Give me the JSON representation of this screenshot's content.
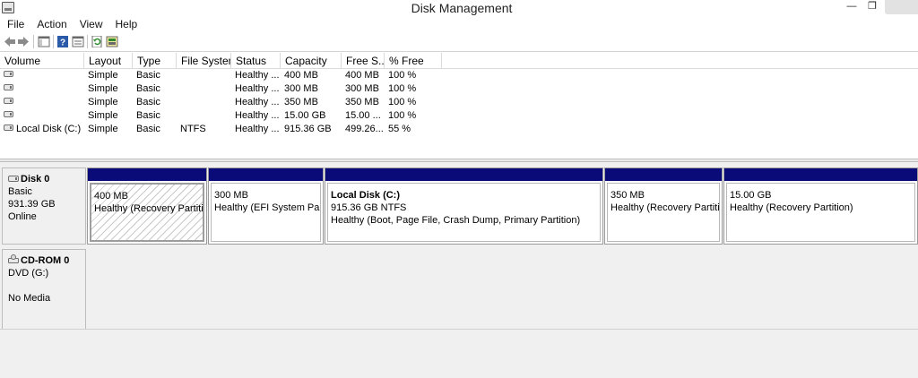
{
  "window": {
    "title": "Disk Management",
    "controls": {
      "minimize": "—",
      "maximize": "❐",
      "close": ""
    }
  },
  "menu": [
    "File",
    "Action",
    "View",
    "Help"
  ],
  "toolbar": {
    "icons": [
      "back-icon",
      "forward-icon",
      "console-tree-icon",
      "help-icon",
      "properties-icon",
      "refresh-icon",
      "rescan-icon"
    ]
  },
  "volume_table": {
    "columns": [
      "Volume",
      "Layout",
      "Type",
      "File System",
      "Status",
      "Capacity",
      "Free S...",
      "% Free"
    ],
    "rows": [
      {
        "volume": "",
        "layout": "Simple",
        "type": "Basic",
        "fs": "",
        "status": "Healthy ...",
        "capacity": "400 MB",
        "free": "400 MB",
        "pct": "100 %"
      },
      {
        "volume": "",
        "layout": "Simple",
        "type": "Basic",
        "fs": "",
        "status": "Healthy ...",
        "capacity": "300 MB",
        "free": "300 MB",
        "pct": "100 %"
      },
      {
        "volume": "",
        "layout": "Simple",
        "type": "Basic",
        "fs": "",
        "status": "Healthy ...",
        "capacity": "350 MB",
        "free": "350 MB",
        "pct": "100 %"
      },
      {
        "volume": "",
        "layout": "Simple",
        "type": "Basic",
        "fs": "",
        "status": "Healthy ...",
        "capacity": "15.00 GB",
        "free": "15.00 ...",
        "pct": "100 %"
      },
      {
        "volume": "Local Disk  (C:)",
        "layout": "Simple",
        "type": "Basic",
        "fs": "NTFS",
        "status": "Healthy ...",
        "capacity": "915.36 GB",
        "free": "499.26...",
        "pct": "55 %"
      }
    ]
  },
  "disks": [
    {
      "name": "Disk 0",
      "type": "Basic",
      "size": "931.39 GB",
      "status": "Online",
      "partitions": [
        {
          "name": "",
          "size": "400 MB",
          "status": "Healthy (Recovery Partition)"
        },
        {
          "name": "",
          "size": "300 MB",
          "status": "Healthy (EFI System Partition)"
        },
        {
          "name": "Local Disk   (C:)",
          "size": "915.36 GB NTFS",
          "status": "Healthy (Boot, Page File, Crash Dump, Primary Partition)"
        },
        {
          "name": "",
          "size": "350 MB",
          "status": "Healthy (Recovery Partition)"
        },
        {
          "name": "",
          "size": "15.00 GB",
          "status": "Healthy (Recovery Partition)"
        }
      ]
    },
    {
      "name": "CD-ROM 0",
      "type": "DVD (G:)",
      "size": "",
      "status": "No Media"
    }
  ],
  "colors": {
    "partition_bar": "#0a0a78",
    "pane_background": "#f0f0f0",
    "selected_hatch": "#c9c9c9"
  }
}
